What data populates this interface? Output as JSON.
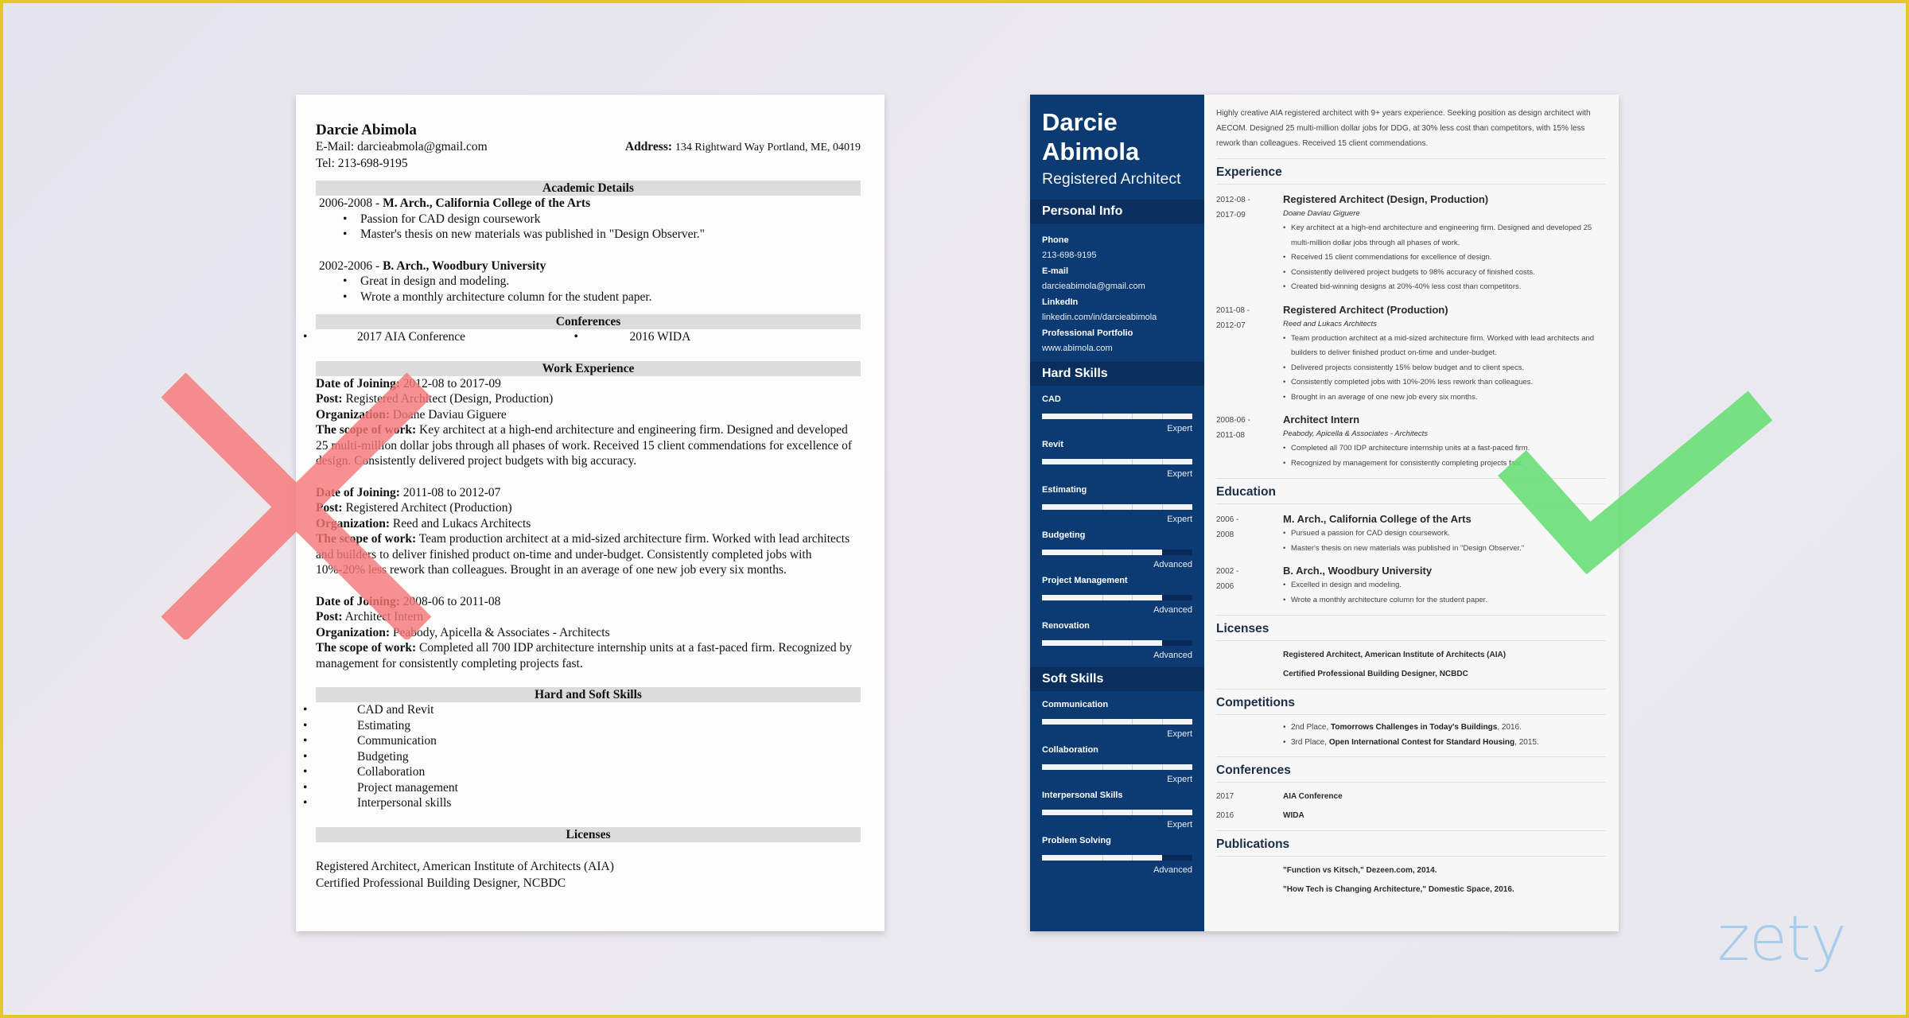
{
  "left_resume": {
    "verdict": "bad",
    "name": "Darcie Abimola",
    "email_label": "E-Mail:",
    "email": "darcieabmola@gmail.com",
    "address_label": "Address:",
    "address": "134 Rightward Way Portland, ME, 04019",
    "tel_label": "Tel:",
    "tel": "213-698-9195",
    "sections": {
      "academic": "Academic Details",
      "conferences": "Conferences",
      "work": "Work Experience",
      "skills": "Hard and Soft Skills",
      "licenses": "Licenses"
    },
    "education": [
      {
        "years": "2006-2008 - ",
        "degree": "M. Arch., California College of the Arts",
        "bullets": [
          "Passion for CAD design coursework",
          "Master's thesis on new materials was published in \"Design Observer.\""
        ]
      },
      {
        "years": "2002-2006 - ",
        "degree": "B. Arch., Woodbury University",
        "bullets": [
          "Great in design and modeling.",
          "Wrote a monthly architecture column for the student paper."
        ]
      }
    ],
    "conferences": [
      "2017 AIA Conference",
      "2016 WIDA"
    ],
    "labels": {
      "date": "Date of Joining:",
      "post": "Post:",
      "org": "Organization:",
      "scope": "The scope of work:"
    },
    "jobs": [
      {
        "dates": " 2012-08 to 2017-09",
        "post": " Registered Architect (Design, Production)",
        "org": " Doane Daviau Giguere",
        "scope": " Key architect at a high-end architecture and engineering firm. Designed and developed 25 multi-million dollar jobs through all phases of work. Received 15 client commendations for excellence of design. Consistently delivered project budgets with big accuracy."
      },
      {
        "dates": " 2011-08 to 2012-07",
        "post": " Registered Architect (Production)",
        "org": " Reed and Lukacs Architects",
        "scope": " Team production architect at a mid-sized architecture firm. Worked with lead architects and builders to deliver finished product on-time and under-budget. Consistently completed jobs with 10%-20% less rework than colleagues. Brought in an average of one new job every six months."
      },
      {
        "dates": " 2008-06 to 2011-08",
        "post": " Architect Intern",
        "org": " Peabody, Apicella & Associates - Architects",
        "scope": " Completed all 700 IDP architecture internship units at a fast-paced firm. Recognized by management for consistently completing projects fast."
      }
    ],
    "skills": [
      "CAD and Revit",
      "Estimating",
      "Communication",
      "Budgeting",
      "Collaboration",
      "Project management",
      "Interpersonal skills"
    ],
    "licenses": [
      "Registered Architect, American Institute of Architects (AIA)",
      "Certified Professional Building Designer, NCBDC"
    ]
  },
  "right_resume": {
    "verdict": "good",
    "colors": {
      "sidebar": "#0c3b74",
      "sidebar_header": "#0a2f5e"
    },
    "first_name": "Darcie",
    "last_name": "Abimola",
    "title": "Registered Architect",
    "personal_info_title": "Personal Info",
    "personal_info": [
      {
        "label": "Phone",
        "value": "213-698-9195"
      },
      {
        "label": "E-mail",
        "value": "darcieabimola@gmail.com"
      },
      {
        "label": "LinkedIn",
        "value": "linkedin.com/in/darcieabimola"
      },
      {
        "label": "Professional Portfolio",
        "value": "www.abimola.com"
      }
    ],
    "hard_skills_title": "Hard Skills",
    "hard_skills": [
      {
        "name": "CAD",
        "level": "Expert",
        "fill": 1.0
      },
      {
        "name": "Revit",
        "level": "Expert",
        "fill": 1.0
      },
      {
        "name": "Estimating",
        "level": "Expert",
        "fill": 1.0
      },
      {
        "name": "Budgeting",
        "level": "Advanced",
        "fill": 0.8
      },
      {
        "name": "Project Management",
        "level": "Advanced",
        "fill": 0.8
      },
      {
        "name": "Renovation",
        "level": "Advanced",
        "fill": 0.8
      }
    ],
    "soft_skills_title": "Soft Skills",
    "soft_skills": [
      {
        "name": "Communication",
        "level": "Expert",
        "fill": 1.0
      },
      {
        "name": "Collaboration",
        "level": "Expert",
        "fill": 1.0
      },
      {
        "name": "Interpersonal Skills",
        "level": "Expert",
        "fill": 1.0
      },
      {
        "name": "Problem Solving",
        "level": "Advanced",
        "fill": 0.8
      }
    ],
    "summary": "Highly creative AIA registered architect with 9+ years experience. Seeking position as design architect with AECOM. Designed 25 multi-million dollar jobs for DDG, at 30% less cost than competitors, with 15% less rework than colleagues. Received 15 client commendations.",
    "sections": {
      "experience": "Experience",
      "education": "Education",
      "licenses": "Licenses",
      "competitions": "Competitions",
      "conferences": "Conferences",
      "publications": "Publications"
    },
    "experience": [
      {
        "date_start": "2012-08 -",
        "date_end": "2017-09",
        "role": "Registered Architect (Design, Production)",
        "org": "Doane Daviau Giguere",
        "bullets": [
          "Key architect at a high-end architecture and engineering firm. Designed and developed 25 multi-million dollar jobs through all phases of work.",
          "Received 15 client commendations for excellence of design.",
          "Consistently delivered project budgets to 98% accuracy of finished costs.",
          "Created bid-winning designs at 20%-40% less cost than competitors."
        ]
      },
      {
        "date_start": "2011-08 -",
        "date_end": "2012-07",
        "role": "Registered Architect (Production)",
        "org": "Reed and Lukacs Architects",
        "bullets": [
          "Team production architect at a mid-sized architecture firm. Worked with lead architects and builders to deliver finished product on-time and under-budget.",
          "Delivered projects consistently 15% below budget and to client specs.",
          "Consistently completed jobs with 10%-20% less rework than colleagues.",
          "Brought in an average of one new job every six months."
        ]
      },
      {
        "date_start": "2008-06 -",
        "date_end": "2011-08",
        "role": "Architect Intern",
        "org": "Peabody, Apicella & Associates - Architects",
        "bullets": [
          "Completed all 700 IDP architecture internship units at a fast-paced firm.",
          "Recognized by management for consistently completing projects fast."
        ]
      }
    ],
    "education": [
      {
        "date_start": "2006 -",
        "date_end": "2008",
        "degree": "M. Arch., California College of the Arts",
        "bullets": [
          "Pursued a passion for CAD design coursework.",
          "Master's thesis on new materials was published in \"Design Observer.\""
        ]
      },
      {
        "date_start": "2002 -",
        "date_end": "2006",
        "degree": "B. Arch., Woodbury University",
        "bullets": [
          "Excelled in design and modeling.",
          "Wrote a monthly architecture column for the student paper."
        ]
      }
    ],
    "licenses": [
      "Registered Architect, American Institute of Architects (AIA)",
      "Certified Professional Building Designer, NCBDC"
    ],
    "competitions": [
      {
        "place": "2nd Place, ",
        "name": "Tomorrows Challenges in Today's Buildings",
        "year": ", 2016."
      },
      {
        "place": "3rd Place, ",
        "name": "Open International Contest for Standard Housing",
        "year": ", 2015."
      }
    ],
    "conferences": [
      {
        "year": "2017",
        "name": "AIA Conference"
      },
      {
        "year": "2016",
        "name": "WIDA"
      }
    ],
    "publications": [
      "\"Function vs Kitsch,\" Dezeen.com, 2014.",
      "\"How Tech is Changing Architecture,\" Domestic Space, 2016."
    ]
  },
  "overlays": {
    "bad_mark": "x-mark",
    "bad_color": "#f78282",
    "good_mark": "check-mark",
    "good_color": "#6fe07a"
  },
  "brand": {
    "logo_text": "zety",
    "logo_color": "#a7cdea",
    "frame_color": "#e3c72c"
  }
}
